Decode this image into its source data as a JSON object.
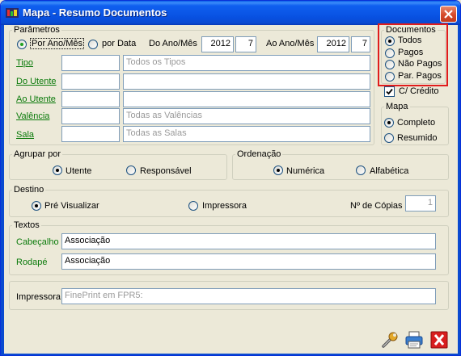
{
  "window": {
    "title": "Mapa - Resumo Documentos"
  },
  "parametros": {
    "legend": "Parâmetros",
    "mode_options": [
      {
        "label": "Por Ano/Mês",
        "selected": true
      },
      {
        "label": "por Data",
        "selected": false
      }
    ],
    "do_ano_mes": {
      "label": "Do Ano/Mês",
      "year": "2012",
      "month": "7"
    },
    "ao_ano_mes": {
      "label": "Ao Ano/Mês",
      "year": "2012",
      "month": "7"
    },
    "rows": [
      {
        "label": "Tipo",
        "code": "",
        "description": "Todos os Tipos"
      },
      {
        "label": "Do Utente",
        "code": "",
        "description": ""
      },
      {
        "label": "Ao Utente",
        "code": "",
        "description": ""
      },
      {
        "label": "Valência",
        "code": "",
        "description": "Todas as Valências"
      },
      {
        "label": "Sala",
        "code": "",
        "description": "Todas as Salas"
      }
    ]
  },
  "documentos": {
    "legend": "Documentos",
    "options": [
      {
        "label": "Todos",
        "selected": true
      },
      {
        "label": "Pagos",
        "selected": false
      },
      {
        "label": "Não Pagos",
        "selected": false
      },
      {
        "label": "Par. Pagos",
        "selected": false
      }
    ]
  },
  "credito": {
    "label": "C/ Crédito",
    "checked": true
  },
  "mapa": {
    "legend": "Mapa",
    "options": [
      {
        "label": "Completo",
        "selected": true
      },
      {
        "label": "Resumido",
        "selected": false
      }
    ]
  },
  "agrupar": {
    "legend": "Agrupar por",
    "options": [
      {
        "label": "Utente",
        "selected": true
      },
      {
        "label": "Responsável",
        "selected": false
      }
    ]
  },
  "ordenacao": {
    "legend": "Ordenação",
    "options": [
      {
        "label": "Numérica",
        "selected": true
      },
      {
        "label": "Alfabética",
        "selected": false
      }
    ]
  },
  "destino": {
    "legend": "Destino",
    "options": [
      {
        "label": "Pré Visualizar",
        "selected": true
      },
      {
        "label": "Impressora",
        "selected": false
      }
    ],
    "copias_label": "Nº de Cópias",
    "copias_value": "1"
  },
  "textos": {
    "legend": "Textos",
    "cabecalho_label": "Cabeçalho",
    "cabecalho_value": "Associação",
    "rodape_label": "Rodapé",
    "rodape_value": "Associação"
  },
  "impressora": {
    "label": "Impressora",
    "value": "FinePrint em FPR5:"
  },
  "toolbar_icons": [
    "wrench-icon",
    "printer-icon",
    "exit-icon"
  ],
  "colors": {
    "label_green": "#0a7a0a",
    "highlight_red": "#e01c1c",
    "titlebar_blue": "#0850e0"
  }
}
